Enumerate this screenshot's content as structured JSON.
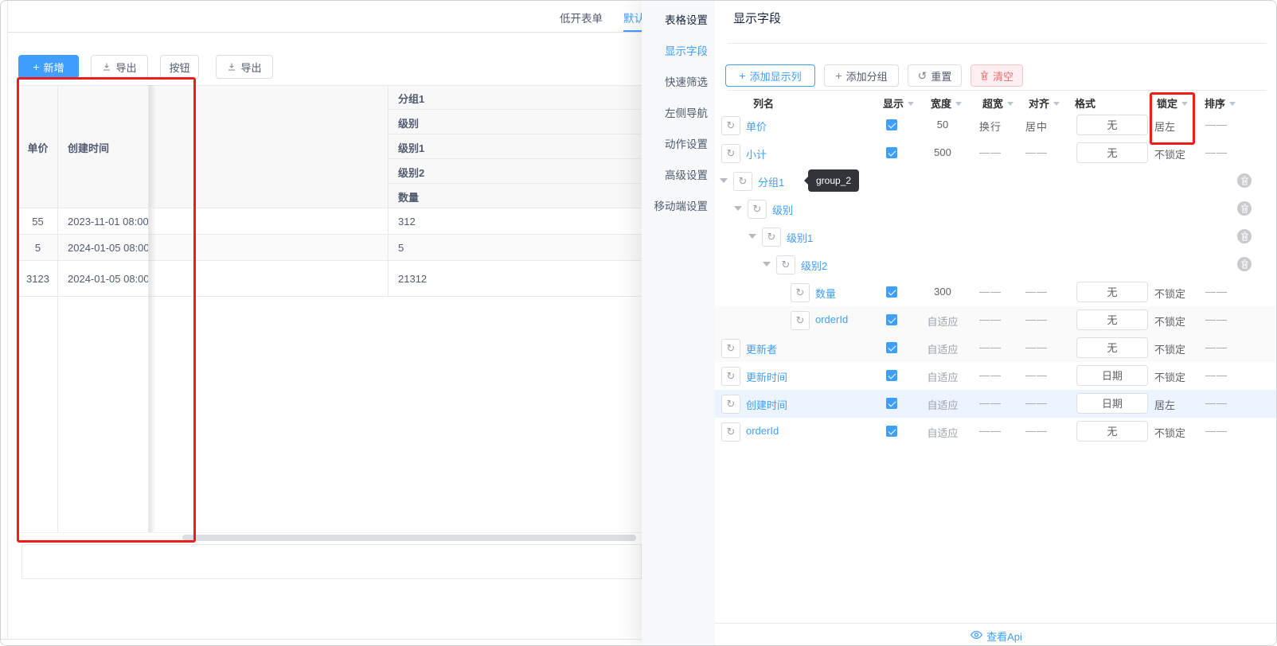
{
  "tabs": [
    {
      "label": "低开表单",
      "active": false
    },
    {
      "label": "默认",
      "active": true
    }
  ],
  "toolbar_buttons": [
    {
      "label": "新增",
      "icon": "plus-icon",
      "type": "primary"
    },
    {
      "label": "导出",
      "icon": "download-icon",
      "type": "default"
    },
    {
      "label": "按钮",
      "icon": "",
      "type": "default"
    },
    {
      "label": "导出",
      "icon": "download-icon",
      "type": "default"
    }
  ],
  "data_table": {
    "fixed_columns": [
      "单价",
      "创建时间"
    ],
    "group_header_rows": [
      "分组1",
      "级别",
      "级别1",
      "级别2",
      "数量"
    ],
    "rows": [
      {
        "price": "55",
        "created": "2023-11-01 08:00",
        "qty": "312"
      },
      {
        "price": "5",
        "created": "2024-01-05 08:00",
        "qty": "5"
      },
      {
        "price": "3123",
        "created": "2024-01-05 08:00",
        "qty": "21312"
      }
    ]
  },
  "settings_panel": {
    "nav_title": "表格设置",
    "nav_items": [
      {
        "label": "显示字段",
        "active": true
      },
      {
        "label": "快速筛选",
        "active": false
      },
      {
        "label": "左侧导航",
        "active": false
      },
      {
        "label": "动作设置",
        "active": false
      },
      {
        "label": "高级设置",
        "active": false
      },
      {
        "label": "移动端设置",
        "active": false
      }
    ],
    "title": "显示字段",
    "action_buttons": [
      {
        "label": "添加显示列",
        "icon": "plus-icon",
        "type": "primary-outline"
      },
      {
        "label": "添加分组",
        "icon": "plus-icon",
        "type": "default"
      },
      {
        "label": "重置",
        "icon": "reset-icon",
        "type": "default"
      },
      {
        "label": "清空",
        "icon": "trash-icon",
        "type": "danger"
      }
    ],
    "grid": {
      "headers": [
        {
          "label": "列名",
          "sortable": false
        },
        {
          "label": "显示",
          "sortable": true
        },
        {
          "label": "宽度",
          "sortable": true
        },
        {
          "label": "超宽",
          "sortable": true
        },
        {
          "label": "对齐",
          "sortable": true
        },
        {
          "label": "格式",
          "sortable": false
        },
        {
          "label": "锁定",
          "sortable": true,
          "annotated": true
        },
        {
          "label": "排序",
          "sortable": true
        }
      ],
      "rows": [
        {
          "name": "单价",
          "level": 0,
          "group": false,
          "checked": true,
          "width": "50",
          "overflow": "换行",
          "align": "居中",
          "format": "无",
          "lock": "居左",
          "sort": "——",
          "lock_annotated": true
        },
        {
          "name": "小计",
          "level": 0,
          "group": false,
          "checked": true,
          "width": "500",
          "overflow": "——",
          "align": "——",
          "format": "无",
          "lock": "不锁定",
          "sort": "——"
        },
        {
          "name": "分组1",
          "level": 0,
          "group": true,
          "tooltip": "group_2"
        },
        {
          "name": "级别",
          "level": 1,
          "group": true
        },
        {
          "name": "级别1",
          "level": 2,
          "group": true
        },
        {
          "name": "级别2",
          "level": 3,
          "group": true
        },
        {
          "name": "数量",
          "level": 4,
          "group": false,
          "checked": true,
          "width": "300",
          "overflow": "——",
          "align": "——",
          "format": "无",
          "lock": "不锁定",
          "sort": "——"
        },
        {
          "name": "orderId",
          "level": 4,
          "group": false,
          "checked": true,
          "width": "自适应",
          "overflow": "——",
          "align": "——",
          "format": "无",
          "lock": "不锁定",
          "sort": "——",
          "striped": true
        },
        {
          "name": "更新者",
          "level": 0,
          "group": false,
          "checked": true,
          "width": "自适应",
          "overflow": "——",
          "align": "——",
          "format": "无",
          "lock": "不锁定",
          "sort": "——",
          "striped": true
        },
        {
          "name": "更新时间",
          "level": 0,
          "group": false,
          "checked": true,
          "width": "自适应",
          "overflow": "——",
          "align": "——",
          "format": "日期",
          "lock": "不锁定",
          "sort": "——"
        },
        {
          "name": "创建时间",
          "level": 0,
          "group": false,
          "checked": true,
          "width": "自适应",
          "overflow": "——",
          "align": "——",
          "format": "日期",
          "lock": "居左",
          "sort": "——",
          "highlighted": true
        },
        {
          "name": "orderId",
          "level": 0,
          "group": false,
          "checked": true,
          "width": "自适应",
          "overflow": "——",
          "align": "——",
          "format": "无",
          "lock": "不锁定",
          "sort": "——"
        }
      ]
    },
    "tooltip_text": "group_2",
    "footer_link": "查看Api"
  },
  "colors": {
    "accent": "#409eff",
    "danger": "#f56c6c",
    "annotation": "#ee1d1d",
    "header_bg": "#f8f8f9",
    "stripe": "#fafafa",
    "highlight_row": "#ecf5ff"
  }
}
